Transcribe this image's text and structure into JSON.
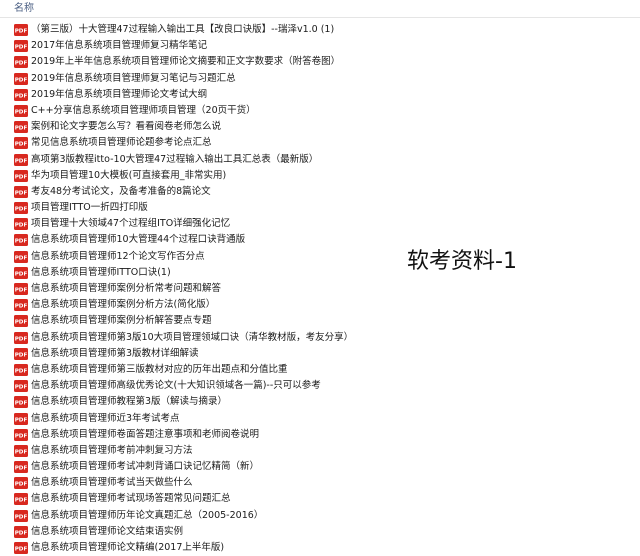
{
  "header": {
    "column_name": "名称"
  },
  "icon_label": "PDF",
  "files": [
    "（第三版）十大管理47过程输入输出工具【改良口诀版】--瑞泽v1.0 (1)",
    "2017年信息系统项目管理师复习精华笔记",
    "2019年上半年信息系统项目管理师论文摘要和正文字数要求（附答卷图）",
    "2019年信息系统项目管理师复习笔记与习题汇总",
    "2019年信息系统项目管理师论文考试大纲",
    "C++分享信息系统项目管理师项目管理（20页干货）",
    "案例和论文字要怎么写？看看阅卷老师怎么说",
    "常见信息系统项目管理师论题参考论点汇总",
    "高项第3版教程itto-10大管理47过程输入输出工具汇总表（最新版）",
    "华为项目管理10大模板(可直接套用_非常实用)",
    "考友48分考试论文，及备考准备的8篇论文",
    "项目管理ITTO一折四打印版",
    "项目管理十大领域47个过程组ITO详细强化记忆",
    "信息系统项目管理师10大管理44个过程口诀背通版",
    "信息系统项目管理师12个论文写作否分点",
    "信息系统项目管理师ITTO口诀(1)",
    "信息系统项目管理师案例分析常考问题和解答",
    "信息系统项目管理师案例分析方法(简化版）",
    "信息系统项目管理师案例分析解答要点专题",
    "信息系统项目管理师第3版10大项目管理领域口诀（清华教材版，考友分享）",
    "信息系统项目管理师第3版教材详细解读",
    "信息系统项目管理师第三版教材对应的历年出题点和分值比重",
    "信息系统项目管理师高级优秀论文(十大知识领域各一篇)--只可以参考",
    "信息系统项目管理师教程第3版（解读与摘录）",
    "信息系统项目管理师近3年考试考点",
    "信息系统项目管理师卷面答题注意事项和老师阅卷说明",
    "信息系统项目管理师考前冲刺复习方法",
    "信息系统项目管理师考试冲刺背诵口诀记忆精简（新）",
    "信息系统项目管理师考试当天做些什么",
    "信息系统项目管理师考试现场答题常见问题汇总",
    "信息系统项目管理师历年论文真题汇总（2005-2016）",
    "信息系统项目管理师论文结束语实例",
    "信息系统项目管理师论文精编(2017上半年版)"
  ],
  "watermark": "软考资料-1",
  "colors": {
    "pdf_red": "#d8281f",
    "header_text": "#4d6185"
  }
}
